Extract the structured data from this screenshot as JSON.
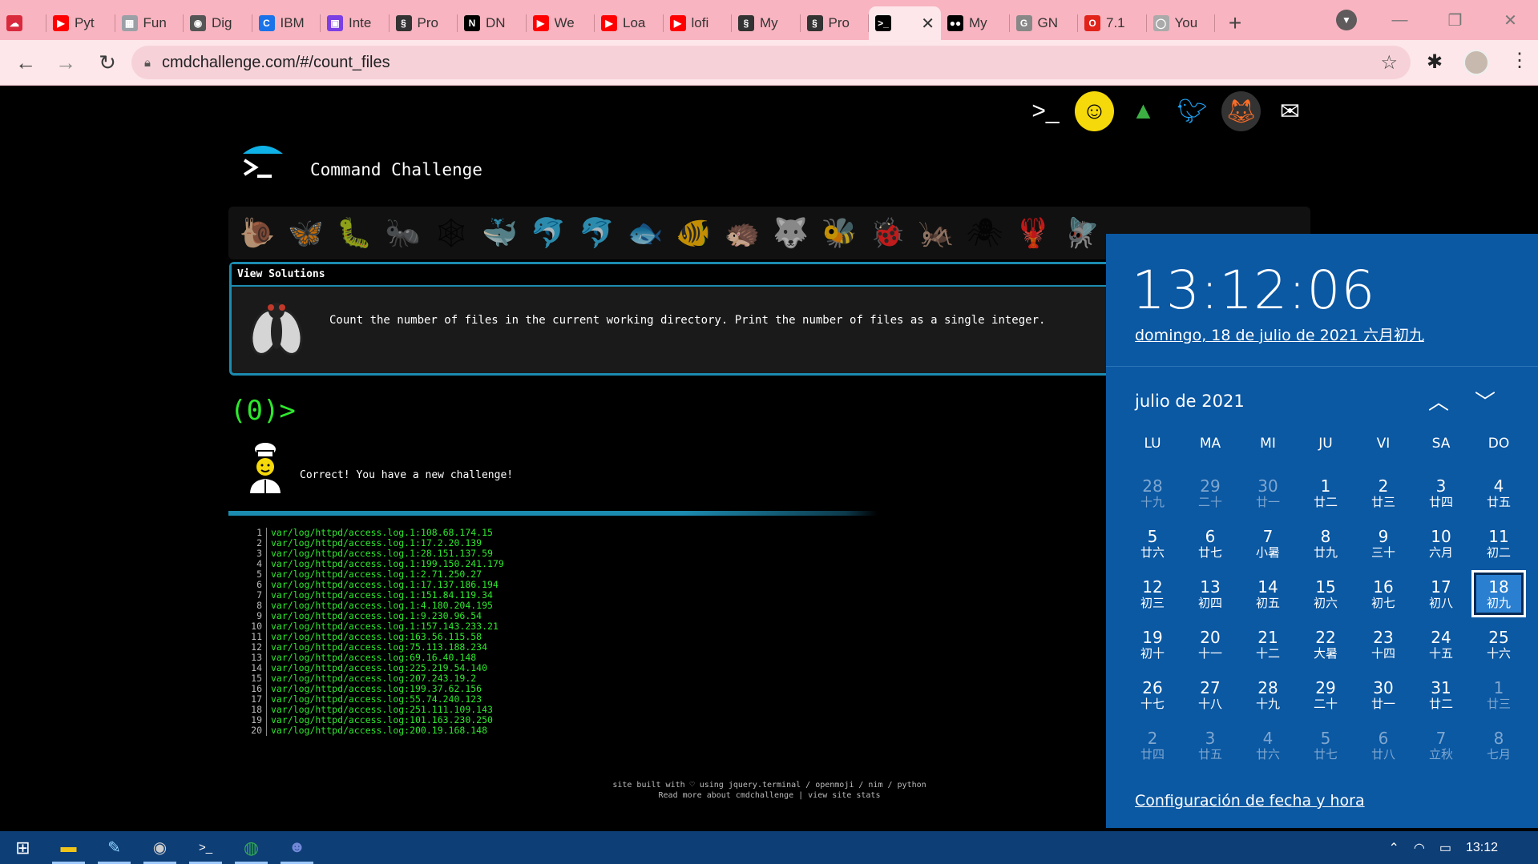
{
  "browser": {
    "tabs": [
      {
        "title": "",
        "icon": "cloud-icon",
        "color": "#d9293d"
      },
      {
        "title": "Pyt",
        "icon": "youtube-icon",
        "color": "#ff0000"
      },
      {
        "title": "Fun",
        "icon": "image-icon",
        "color": "#9aa0a6"
      },
      {
        "title": "Dig",
        "icon": "frog-icon",
        "color": "#555555"
      },
      {
        "title": "IBM",
        "icon": "ibm-icon",
        "color": "#1a73e8"
      },
      {
        "title": "Inte",
        "icon": "app-icon",
        "color": "#7b3fe4"
      },
      {
        "title": "Pro",
        "icon": "seahorse-icon",
        "color": "#333333"
      },
      {
        "title": "DN",
        "icon": "notion-icon",
        "color": "#000000"
      },
      {
        "title": "We",
        "icon": "youtube-icon",
        "color": "#ff0000"
      },
      {
        "title": "Loa",
        "icon": "youtube-icon",
        "color": "#ff0000"
      },
      {
        "title": "lofi",
        "icon": "youtube-icon",
        "color": "#ff0000"
      },
      {
        "title": "My",
        "icon": "seahorse-icon",
        "color": "#333333"
      },
      {
        "title": "Pro",
        "icon": "seahorse-icon",
        "color": "#333333"
      },
      {
        "title": "",
        "icon": "terminal-icon",
        "color": "#000000",
        "active": true
      },
      {
        "title": "My",
        "icon": "medium-icon",
        "color": "#000000"
      },
      {
        "title": "GN",
        "icon": "gnu-icon",
        "color": "#888888"
      },
      {
        "title": "7.1",
        "icon": "opera-icon",
        "color": "#e2231a"
      },
      {
        "title": "You",
        "icon": "github-icon",
        "color": "#aaaaaa"
      }
    ],
    "active_close": "✕",
    "new_tab": "+",
    "url": "cmdchallenge.com/#/count_files"
  },
  "page": {
    "brand_title": "Command Challenge",
    "social_icons": [
      "terminal-logo-icon",
      "face-icon",
      "tree-icon",
      "twitter-icon",
      "gitlab-icon",
      "mail-icon"
    ],
    "animals": [
      "🐌",
      "🦋",
      "🐛",
      "🐜",
      "🕸",
      "🐳",
      "🐬",
      "🐬",
      "🐟",
      "🐠",
      "🦔",
      "🐺",
      "🐝",
      "🐞",
      "🦗",
      "🕷",
      "🦞",
      "🪰"
    ],
    "challenge": {
      "header": "View Solutions",
      "text": "Count the number of files in the current working directory. Print the number of files as a single integer."
    },
    "prompt": "(0)>",
    "correct_message": "Correct! You have a new challenge!",
    "output_lines": [
      {
        "n": "1",
        "t": "var/log/httpd/access.log.1:108.68.174.15"
      },
      {
        "n": "2",
        "t": "var/log/httpd/access.log.1:17.2.20.139"
      },
      {
        "n": "3",
        "t": "var/log/httpd/access.log.1:28.151.137.59"
      },
      {
        "n": "4",
        "t": "var/log/httpd/access.log.1:199.150.241.179"
      },
      {
        "n": "5",
        "t": "var/log/httpd/access.log.1:2.71.250.27"
      },
      {
        "n": "6",
        "t": "var/log/httpd/access.log.1:17.137.186.194"
      },
      {
        "n": "7",
        "t": "var/log/httpd/access.log.1:151.84.119.34"
      },
      {
        "n": "8",
        "t": "var/log/httpd/access.log.1:4.180.204.195"
      },
      {
        "n": "9",
        "t": "var/log/httpd/access.log.1:9.230.96.54"
      },
      {
        "n": "10",
        "t": "var/log/httpd/access.log.1:157.143.233.21"
      },
      {
        "n": "11",
        "t": "var/log/httpd/access.log:163.56.115.58"
      },
      {
        "n": "12",
        "t": "var/log/httpd/access.log:75.113.188.234"
      },
      {
        "n": "13",
        "t": "var/log/httpd/access.log:69.16.40.148"
      },
      {
        "n": "14",
        "t": "var/log/httpd/access.log:225.219.54.140"
      },
      {
        "n": "15",
        "t": "var/log/httpd/access.log:207.243.19.2"
      },
      {
        "n": "16",
        "t": "var/log/httpd/access.log:199.37.62.156"
      },
      {
        "n": "17",
        "t": "var/log/httpd/access.log:55.74.240.123"
      },
      {
        "n": "18",
        "t": "var/log/httpd/access.log:251.111.109.143"
      },
      {
        "n": "19",
        "t": "var/log/httpd/access.log:101.163.230.250"
      },
      {
        "n": "20",
        "t": "var/log/httpd/access.log:200.19.168.148"
      }
    ],
    "footer_line1": "site built with ♡ using jquery.terminal / openmoji / nim / python",
    "footer_line2": "Read more about cmdchallenge | view site stats"
  },
  "flyout": {
    "time": "13:12:06",
    "date": "domingo, 18 de julio de 2021 六月初九",
    "month": "julio de 2021",
    "weekdays": [
      "LU",
      "MA",
      "MI",
      "JU",
      "VI",
      "SA",
      "DO"
    ],
    "days": [
      {
        "d": "28",
        "l": "十九",
        "o": true
      },
      {
        "d": "29",
        "l": "二十",
        "o": true
      },
      {
        "d": "30",
        "l": "廿一",
        "o": true
      },
      {
        "d": "1",
        "l": "廿二"
      },
      {
        "d": "2",
        "l": "廿三"
      },
      {
        "d": "3",
        "l": "廿四"
      },
      {
        "d": "4",
        "l": "廿五"
      },
      {
        "d": "5",
        "l": "廿六"
      },
      {
        "d": "6",
        "l": "廿七"
      },
      {
        "d": "7",
        "l": "小暑"
      },
      {
        "d": "8",
        "l": "廿九"
      },
      {
        "d": "9",
        "l": "三十"
      },
      {
        "d": "10",
        "l": "六月"
      },
      {
        "d": "11",
        "l": "初二"
      },
      {
        "d": "12",
        "l": "初三"
      },
      {
        "d": "13",
        "l": "初四"
      },
      {
        "d": "14",
        "l": "初五"
      },
      {
        "d": "15",
        "l": "初六"
      },
      {
        "d": "16",
        "l": "初七"
      },
      {
        "d": "17",
        "l": "初八"
      },
      {
        "d": "18",
        "l": "初九",
        "today": true
      },
      {
        "d": "19",
        "l": "初十"
      },
      {
        "d": "20",
        "l": "十一"
      },
      {
        "d": "21",
        "l": "十二"
      },
      {
        "d": "22",
        "l": "大暑"
      },
      {
        "d": "23",
        "l": "十四"
      },
      {
        "d": "24",
        "l": "十五"
      },
      {
        "d": "25",
        "l": "十六"
      },
      {
        "d": "26",
        "l": "十七"
      },
      {
        "d": "27",
        "l": "十八"
      },
      {
        "d": "28",
        "l": "十九"
      },
      {
        "d": "29",
        "l": "二十"
      },
      {
        "d": "30",
        "l": "廿一"
      },
      {
        "d": "31",
        "l": "廿二"
      },
      {
        "d": "1",
        "l": "廿三",
        "o": true
      },
      {
        "d": "2",
        "l": "廿四",
        "o": true
      },
      {
        "d": "3",
        "l": "廿五",
        "o": true
      },
      {
        "d": "4",
        "l": "廿六",
        "o": true
      },
      {
        "d": "5",
        "l": "廿七",
        "o": true
      },
      {
        "d": "6",
        "l": "廿八",
        "o": true
      },
      {
        "d": "7",
        "l": "立秋",
        "o": true
      },
      {
        "d": "8",
        "l": "七月",
        "o": true
      }
    ],
    "settings_link": "Configuración de fecha y hora"
  },
  "taskbar": {
    "apps": [
      "start-icon",
      "file-explorer-icon",
      "notepad-icon",
      "app-icon",
      "terminal-icon",
      "chrome-icon",
      "discord-icon"
    ],
    "clock": "13:12"
  }
}
